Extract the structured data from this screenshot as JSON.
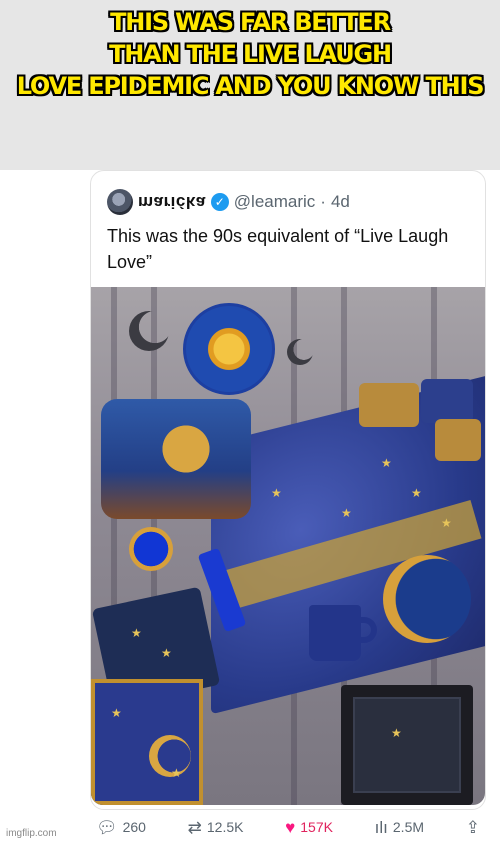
{
  "meme": {
    "caption_lines": [
      "THIS WAS FAR BETTER",
      "THAN THE LIVE LAUGH",
      "LOVE EPIDEMIC AND YOU KNOW THIS"
    ],
    "caption_color": "#ffe800",
    "band_color": "#e6e6e6"
  },
  "tweet": {
    "display_name": "marićka",
    "handle": "@leamaric",
    "separator": "·",
    "time": "4d",
    "text": "This was the 90s equivalent of “Live Laugh Love”",
    "verified": true,
    "accent_color": "#1d9bf0"
  },
  "footer": {
    "replies": "260",
    "reposts": "12.5K",
    "likes": "157K",
    "views": "2.5M",
    "like_color": "#f91880"
  },
  "watermark": "imgflip.com",
  "icons": {
    "reply": "comment-bubble-icon",
    "repost": "repost-arrows-icon",
    "like": "heart-icon",
    "views": "bar-chart-icon",
    "share": "share-upload-icon",
    "verified": "verified-check-icon"
  }
}
